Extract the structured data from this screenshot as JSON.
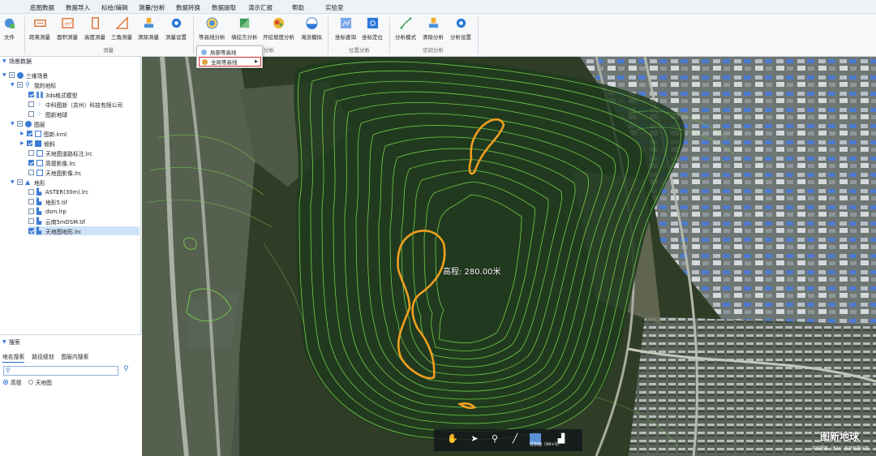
{
  "menu": [
    "底图数据",
    "数据导入",
    "标绘/编辑",
    "测量/分析",
    "数据转换",
    "数据提取",
    "演示汇报",
    "帮助",
    "实验室"
  ],
  "ribbon": {
    "file_label": "文件",
    "measure_buttons": [
      "距离测量",
      "面积测量",
      "高度测量",
      "三角测量",
      "清除测量",
      "测量设置"
    ],
    "measure_group": "测量",
    "analysis_buttons": [
      "等高线分析",
      "填挖方分析",
      "开挖坡度分析",
      "淹没模拟"
    ],
    "analysis_group": "分析",
    "position_buttons": [
      "坐标查询",
      "坐标定位"
    ],
    "position_group": "位置分析",
    "space_buttons": [
      "分析模式",
      "清除分析",
      "分析设置"
    ],
    "space_group": "空间分析"
  },
  "contour_dropdown": {
    "items": [
      "局部等高线",
      "全局等高线"
    ],
    "selected": "全局等高线"
  },
  "scene_panel": {
    "title": "场景数据",
    "tree": [
      {
        "label": "三维场景",
        "indent": 0
      },
      {
        "label": "我的地标",
        "indent": 1
      },
      {
        "label": "3ds格式模型",
        "indent": 2
      },
      {
        "label": "中科图新（苏州）科技有限公司",
        "indent": 2
      },
      {
        "label": "图新地球",
        "indent": 2
      },
      {
        "label": "图层",
        "indent": 1
      },
      {
        "label": "图新.kml",
        "indent": 2
      },
      {
        "label": "倾斜",
        "indent": 2
      },
      {
        "label": "天地图道路标注.lrc",
        "indent": 2
      },
      {
        "label": "高德影像.lrc",
        "indent": 2
      },
      {
        "label": "天地图影像.lrc",
        "indent": 2
      },
      {
        "label": "地形",
        "indent": 1
      },
      {
        "label": "ASTER(30m).lrc",
        "indent": 2
      },
      {
        "label": "地形5.tif",
        "indent": 2
      },
      {
        "label": "dsm.lrp",
        "indent": 2
      },
      {
        "label": "云南5mDSM.tif",
        "indent": 2
      },
      {
        "label": "天地图地形.lrc",
        "indent": 2
      }
    ]
  },
  "search_panel": {
    "title": "搜索",
    "tabs": [
      "地名搜索",
      "路径规划",
      "图层内搜索"
    ],
    "input_value": "",
    "radio_options": [
      "高德",
      "天地图"
    ],
    "radio_selected": "高德"
  },
  "map": {
    "elevation_label": "高程: 280.00米",
    "brand": "图新地球",
    "brand_sub": "中科图新（苏州）科技有限公司",
    "toolbar_label": "径剖面（Alt+5）"
  },
  "icons": [
    "file-icon",
    "distance-icon",
    "area-icon",
    "height-icon",
    "triangle-icon",
    "clear-icon",
    "settings-icon",
    "contour-icon",
    "fill-cut-icon",
    "slope-icon",
    "flood-icon",
    "coord-query-icon",
    "coord-locate-icon",
    "analysis-mode-icon",
    "hand-icon",
    "cursor-icon",
    "pin-icon",
    "line-icon",
    "square-icon",
    "profile-icon",
    "search-icon"
  ],
  "colors": {
    "accent": "#2a6fd1",
    "contour_highlight": "#f0a020",
    "contour_green": "#6fcf4a"
  }
}
